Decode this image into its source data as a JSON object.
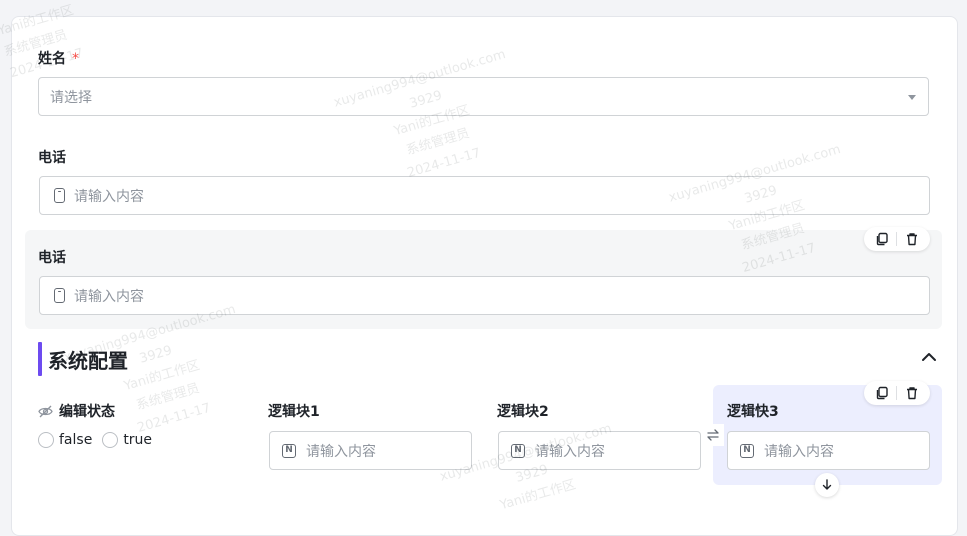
{
  "form": {
    "name_field": {
      "label": "姓名",
      "required_mark": "*",
      "placeholder": "请选择"
    },
    "phone_field_1": {
      "label": "电话",
      "placeholder": "请输入内容"
    },
    "phone_field_2": {
      "label": "电话",
      "placeholder": "请输入内容"
    }
  },
  "section": {
    "title": "系统配置",
    "accent_color": "#6d4bf0",
    "edit_state": {
      "label": "编辑状态",
      "options": [
        "false",
        "true"
      ]
    },
    "logic_blocks": [
      {
        "label": "逻辑块1",
        "placeholder": "请输入内容"
      },
      {
        "label": "逻辑块2",
        "placeholder": "请输入内容"
      },
      {
        "label": "逻辑快3",
        "placeholder": "请输入内容"
      }
    ]
  },
  "watermark": {
    "email": "xuyaning994@outlook.com",
    "id": "3929",
    "workspace": "Yani的工作区",
    "role": "系统管理员",
    "date": "2024-11-17"
  },
  "icons": {
    "phone": "phone-icon",
    "number": "number-icon",
    "copy": "copy-icon",
    "delete": "trash-icon",
    "collapse": "chevron-up-icon",
    "hidden": "eye-off-icon",
    "swap": "swap-horizontal-icon",
    "move_down": "arrow-down-icon",
    "dropdown": "caret-down-icon"
  }
}
